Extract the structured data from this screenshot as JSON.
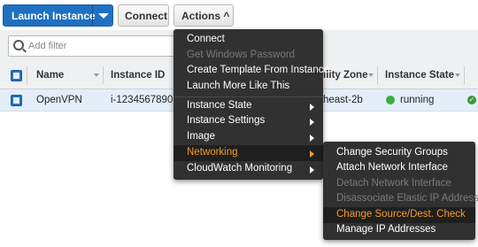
{
  "toolbar": {
    "launch_label": "Launch Instance",
    "connect_label": "Connect",
    "actions_label": "Actions ^"
  },
  "filter": {
    "placeholder": "Add filter"
  },
  "table": {
    "headers": [
      "Name",
      "Instance ID",
      "ility Zone",
      "Instance State"
    ],
    "row": {
      "name": "OpenVPN",
      "instance_id": "i-1234567890",
      "zone": "heast-2b",
      "state": "running",
      "state_color": "#3cae3c"
    }
  },
  "actions_menu": {
    "items": [
      {
        "label": "Connect",
        "enabled": true
      },
      {
        "label": "Get Windows Password",
        "enabled": false
      },
      {
        "label": "Create Template From Instance",
        "enabled": true
      },
      {
        "label": "Launch More Like This",
        "enabled": true
      },
      {
        "label": "Instance State",
        "submenu": true
      },
      {
        "label": "Instance Settings",
        "submenu": true
      },
      {
        "label": "Image",
        "submenu": true
      },
      {
        "label": "Networking",
        "submenu": true,
        "highlighted": true
      },
      {
        "label": "CloudWatch Monitoring",
        "submenu": true
      }
    ]
  },
  "networking_menu": {
    "items": [
      {
        "label": "Change Security Groups",
        "enabled": true
      },
      {
        "label": "Attach Network Interface",
        "enabled": true
      },
      {
        "label": "Detach Network Interface",
        "enabled": false
      },
      {
        "label": "Disassociate Elastic IP Address",
        "enabled": false
      },
      {
        "label": "Change Source/Dest. Check",
        "enabled": true,
        "hovered": true
      },
      {
        "label": "Manage IP Addresses",
        "enabled": true
      }
    ]
  },
  "colors": {
    "accent": "#1f70c1",
    "menu_bg": "#313131",
    "menu_highlight": "#f39c2c",
    "row_selected": "#e4eef9"
  }
}
